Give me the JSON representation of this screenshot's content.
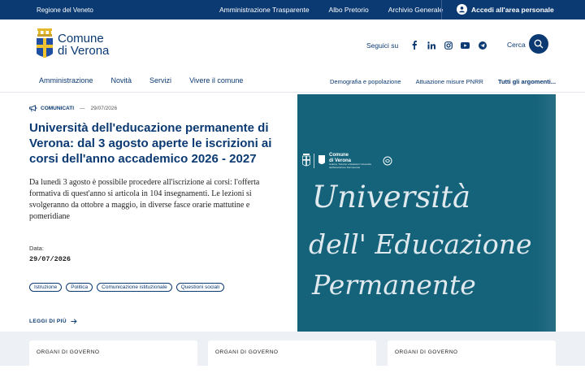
{
  "topbar": {
    "region": "Regione del Veneto",
    "links": [
      "Amministrazione Trasparente",
      "Albo Pretorio",
      "Archivio Generale"
    ],
    "login": "Accedi all'area personale"
  },
  "header": {
    "logo_line1": "Comune",
    "logo_line2": "di Verona",
    "social_label": "Seguici su",
    "search_label": "Cerca"
  },
  "nav": {
    "main": [
      "Amministrazione",
      "Novità",
      "Servizi",
      "Vivere il comune"
    ],
    "secondary": [
      "Demografia e popolazione",
      "Attuazione misure PNRR",
      "Tutti gli argomenti..."
    ]
  },
  "article": {
    "category": "COMUNICATI",
    "dash": "—",
    "date": "29/07/2026",
    "title": "Università dell'educazione permanente di Verona: dal 3 agosto aperte le iscrizioni ai corsi dell'anno accademico 2026 - 2027",
    "lead": "Da lunedì 3 agosto è possibile procedere all'iscrizione ai corsi: l'offerta formativa di quest'anno si articola in 104 insegnamenti. Le lezioni si svolgeranno da ottobre a maggio, in diverse fasce orarie mattutine e pomeridiane",
    "date_label": "Data:",
    "date_value": "29/07/2026",
    "tags": [
      "Istruzione",
      "Politica",
      "Comunicazione istituzionale",
      "Questioni sociali"
    ],
    "read_more": "LEGGI DI PIÙ"
  },
  "hero": {
    "logo_line1": "Comune",
    "logo_line2": "di Verona",
    "logo_small": "Cultura, Turismo e Relazioni Università dell'Educazione Permanente",
    "line1": "Università",
    "line2": "dell' Educazione",
    "line3": "Permanente",
    "bg_color": "#15637a"
  },
  "cards": [
    "ORGANI DI GOVERNO",
    "ORGANI DI GOVERNO",
    "ORGANI DI GOVERNO"
  ],
  "colors": {
    "primary": "#0b3a73",
    "hero": "#15637a"
  }
}
